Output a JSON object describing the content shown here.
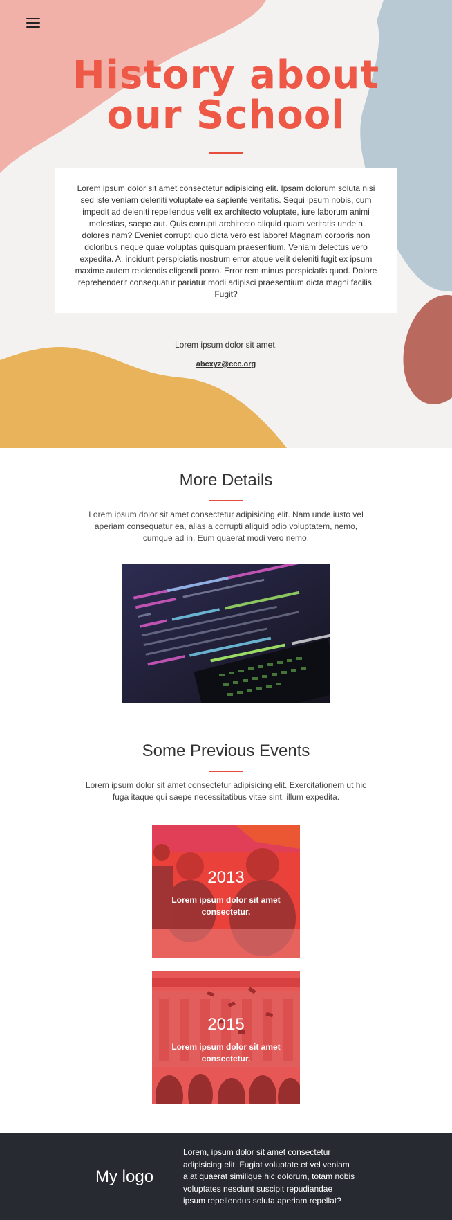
{
  "hero": {
    "title_line1": "History about",
    "title_line2": "our School",
    "paragraph": "Lorem ipsum dolor sit amet consectetur adipisicing elit. Ipsam dolorum soluta nisi sed iste veniam deleniti voluptate ea sapiente veritatis. Sequi ipsum nobis, cum impedit ad deleniti repellendus velit ex architecto voluptate, iure laborum animi molestias, saepe aut. Quis corrupti architecto aliquid quam veritatis unde a dolores nam? Eveniet corrupti quo dicta vero est labore! Magnam corporis non doloribus neque quae voluptas quisquam praesentium. Veniam delectus vero expedita. A, incidunt perspiciatis nostrum error atque velit deleniti fugit ex ipsum maxime autem reiciendis eligendi porro. Error rem minus perspiciatis quod. Dolore reprehenderit consequatur pariatur modi adipisci praesentium dicta magni facilis. Fugit?",
    "small_text": "Lorem ipsum dolor sit amet.",
    "email": "abcxyz@ccc.org",
    "menu_icon": "hamburger-menu-icon"
  },
  "details": {
    "title": "More Details",
    "text": "Lorem ipsum dolor sit amet consectetur adipisicing elit. Nam unde iusto vel aperiam consequatur ea, alias a corrupti aliquid odio voluptatem, nemo, cumque ad in. Eum quaerat modi vero nemo.",
    "code_lines": [
      "@link https://...",
      "@package _s",
      "*/",
      "if ( ! function_exists( 'inchem_starter_setup' ) ) :",
      "function inchem_starter_setup() {"
    ]
  },
  "events": {
    "title": "Some Previous Events",
    "text": "Lorem ipsum dolor sit amet consectetur adipisicing elit. Exercitationem ut hic fuga itaque qui saepe necessitatibus vitae sint, illum expedita.",
    "items": [
      {
        "year": "2013",
        "description": "Lorem ipsum dolor sit amet consectetur."
      },
      {
        "year": "2015",
        "description": "Lorem ipsum dolor sit amet consectetur."
      }
    ]
  },
  "footer": {
    "logo": "My logo",
    "text": "Lorem, ipsum dolor sit amet consectetur adipisicing elit. Fugiat voluptate et vel veniam a at quaerat similique hic dolorum, totam nobis voluptates nesciunt suscipit repudiandae ipsum repellendus soluta aperiam repellat?"
  },
  "colors": {
    "accent": "#ee5846",
    "rule": "#e84c3d",
    "blob_pink": "#f2b1a8",
    "blob_blue": "#b9c9d3",
    "blob_yellow": "#e8b35a",
    "blob_brown": "#b9695e",
    "footer_bg": "#272a31",
    "event_overlay": "#f23a3a"
  }
}
